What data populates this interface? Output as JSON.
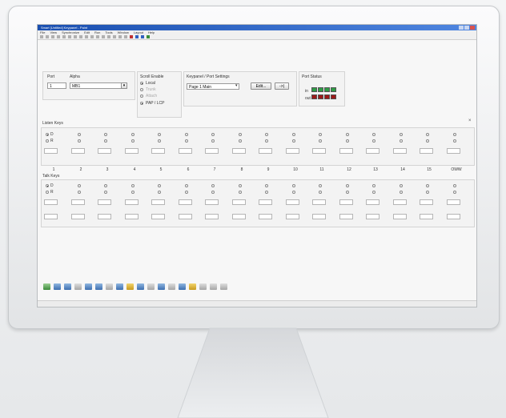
{
  "window": {
    "title": "Smart   [Untitled]   Keypanel - Paint"
  },
  "menu": [
    "File",
    "View",
    "Synchronize",
    "Edit",
    "Run",
    "Tools",
    "Window",
    "Layout",
    "Help"
  ],
  "port": {
    "port_label": "Port",
    "alpha_label": "Alpha",
    "port_value": "1",
    "alpha_value": "MB1"
  },
  "scroll": {
    "label": "Scroll Enable",
    "options": [
      "Local",
      "Trunk",
      "Attach",
      "PAP / LCP"
    ]
  },
  "keypanel": {
    "label": "Keypanel / Port Settings",
    "page_value": "Page 1 Main",
    "edit_button": "Edit...",
    "arrow_button": "->|"
  },
  "port_status": {
    "label": "Port Status",
    "row1": "in",
    "row2": "out"
  },
  "listen": {
    "label": "Listen Keys",
    "radio_labels": [
      "D",
      "R"
    ],
    "close": "×"
  },
  "talk": {
    "label": "Talk Keys",
    "radio_labels": [
      "D",
      "R"
    ]
  },
  "columns": [
    "1",
    "2",
    "3",
    "4",
    "5",
    "6",
    "7",
    "8",
    "9",
    "10",
    "11",
    "12",
    "13",
    "14",
    "15",
    "OWW"
  ],
  "colors": {
    "titlebar": "#1a4fb0",
    "led_green": "#2e9d46",
    "led_red": "#9c1a1a"
  }
}
